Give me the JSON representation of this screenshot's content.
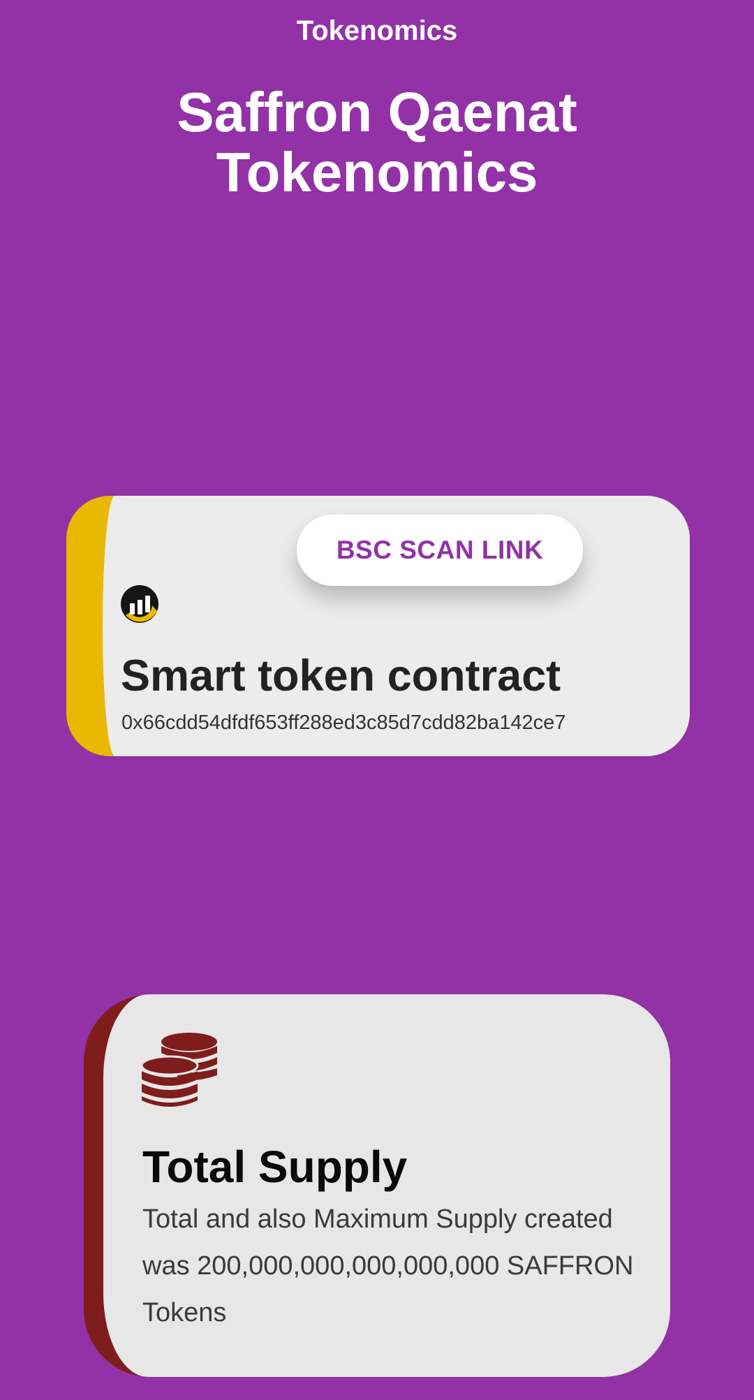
{
  "header": {
    "section_label": "Tokenomics",
    "title_line1": "Saffron Qaenat",
    "title_line2": "Tokenomics"
  },
  "contract_card": {
    "button_label": "BSC SCAN LINK",
    "icon": "chart-bars-icon",
    "title": "Smart token contract",
    "address": "0x66cdd54dfdf653ff288ed3c85d7cdd82ba142ce7"
  },
  "supply_card": {
    "icon": "coins-stack-icon",
    "title": "Total Supply",
    "description": "Total and also Maximum Supply created was 200,000,000,000,000,000 SAFFRON Tokens"
  },
  "colors": {
    "background": "#9232a6",
    "accent_yellow": "#e9b800",
    "accent_maroon": "#7f1d1d",
    "card_face": "#ececec"
  }
}
